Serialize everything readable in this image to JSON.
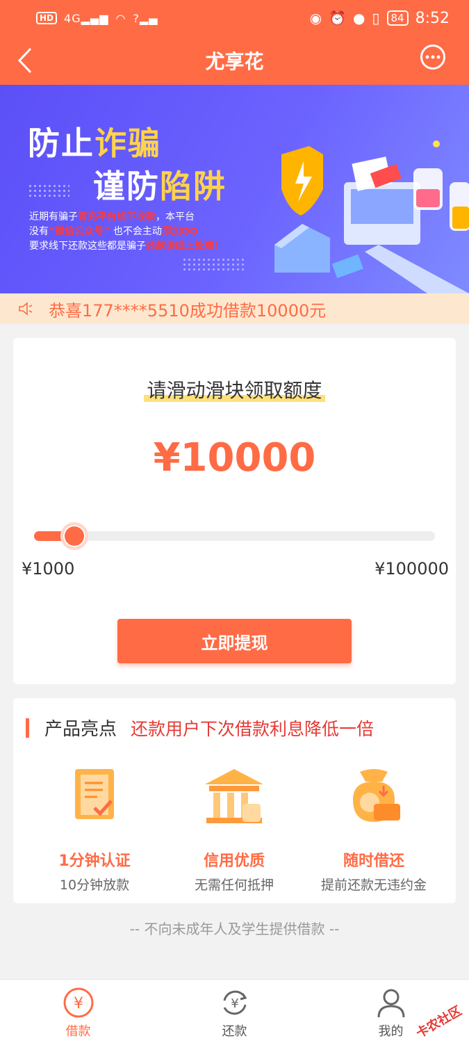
{
  "status_bar": {
    "left": [
      "HD",
      "4G",
      "?"
    ],
    "battery": "84",
    "time": "8:52"
  },
  "header": {
    "title": "尤享花",
    "back_icon": "chevron-left-icon",
    "menu_icon": "more-dots-icon"
  },
  "banner": {
    "line1_a": "防止",
    "line1_b": "诈骗",
    "line2_a": "谨防",
    "line2_b": "陷阱",
    "warn1_a": "近期有骗子",
    "warn1_b": "冒充平台线下收款",
    "warn1_c": "，本平台",
    "warn2_a": "没有",
    "warn2_b": "“微信公众号”",
    "warn2_c": "也不会主动",
    "warn2_d": "添加QQ",
    "warn3_a": "要求线下还款这些都是骗子",
    "warn3_b": "还款请线上处理!"
  },
  "notice": {
    "text": "恭喜177****5510成功借款10000元",
    "icon": "speaker-icon"
  },
  "amount_card": {
    "prompt": "请滑动滑块领取额度",
    "amount": "¥10000",
    "slider_fraction": 0.1,
    "min_label": "¥1000",
    "max_label": "¥100000",
    "button": "立即提现"
  },
  "features": {
    "heading": "产品亮点",
    "promo": "还款用户下次借款利息降低一倍",
    "items": [
      {
        "title": "1分钟认证",
        "sub": "10分钟放款",
        "icon": "document-check-icon"
      },
      {
        "title": "信用优质",
        "sub": "无需任何抵押",
        "icon": "bank-icon"
      },
      {
        "title": "随时借还",
        "sub": "提前还款无违约金",
        "icon": "money-bag-icon"
      }
    ]
  },
  "disclaimer": "-- 不向未成年人及学生提供借款 --",
  "bottom_nav": [
    {
      "label": "借款",
      "icon": "yuan-circle-icon",
      "active": true
    },
    {
      "label": "还款",
      "icon": "yuan-refresh-icon",
      "active": false
    },
    {
      "label": "我的",
      "icon": "user-icon",
      "active": false
    }
  ],
  "watermark": "卡农社区",
  "colors": {
    "brand": "#ff6b45",
    "banner": "#5b4ff7",
    "notice_bg": "#fde8cf",
    "promo_red": "#e53935"
  }
}
